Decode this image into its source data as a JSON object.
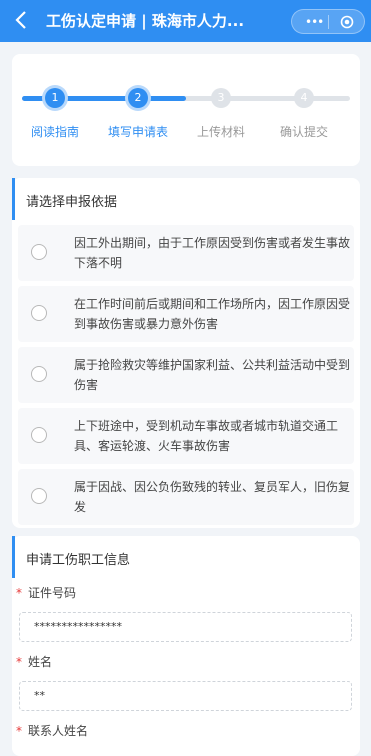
{
  "header": {
    "title": "工伤认定申请 | 珠海市人力...",
    "more_label": "•••"
  },
  "steps": [
    {
      "num": "1",
      "label": "阅读指南",
      "state": "done"
    },
    {
      "num": "2",
      "label": "填写申请表",
      "state": "current"
    },
    {
      "num": "3",
      "label": "上传材料",
      "state": "todo"
    },
    {
      "num": "4",
      "label": "确认提交",
      "state": "todo"
    }
  ],
  "basis": {
    "title": "请选择申报依据",
    "options": [
      "因工外出期间，由于工作原因受到伤害或者发生事故下落不明",
      "在工作时间前后或期间和工作场所内，因工作原因受到事故伤害或暴力意外伤害",
      "属于抢险救灾等维护国家利益、公共利益活动中受到伤害",
      "上下班途中，受到机动车事故或者城市轨道交通工具、客运轮渡、火车事故伤害",
      "属于因战、因公负伤致残的转业、复员军人，旧伤复发"
    ]
  },
  "employee": {
    "title": "申请工伤职工信息",
    "id_label": "证件号码",
    "id_value": "****************",
    "name_label": "姓名",
    "name_value": "**",
    "contact_label": "联系人姓名",
    "required_mark": "*"
  },
  "colors": {
    "accent": "#2f8ef2",
    "required": "#e63a3a"
  }
}
